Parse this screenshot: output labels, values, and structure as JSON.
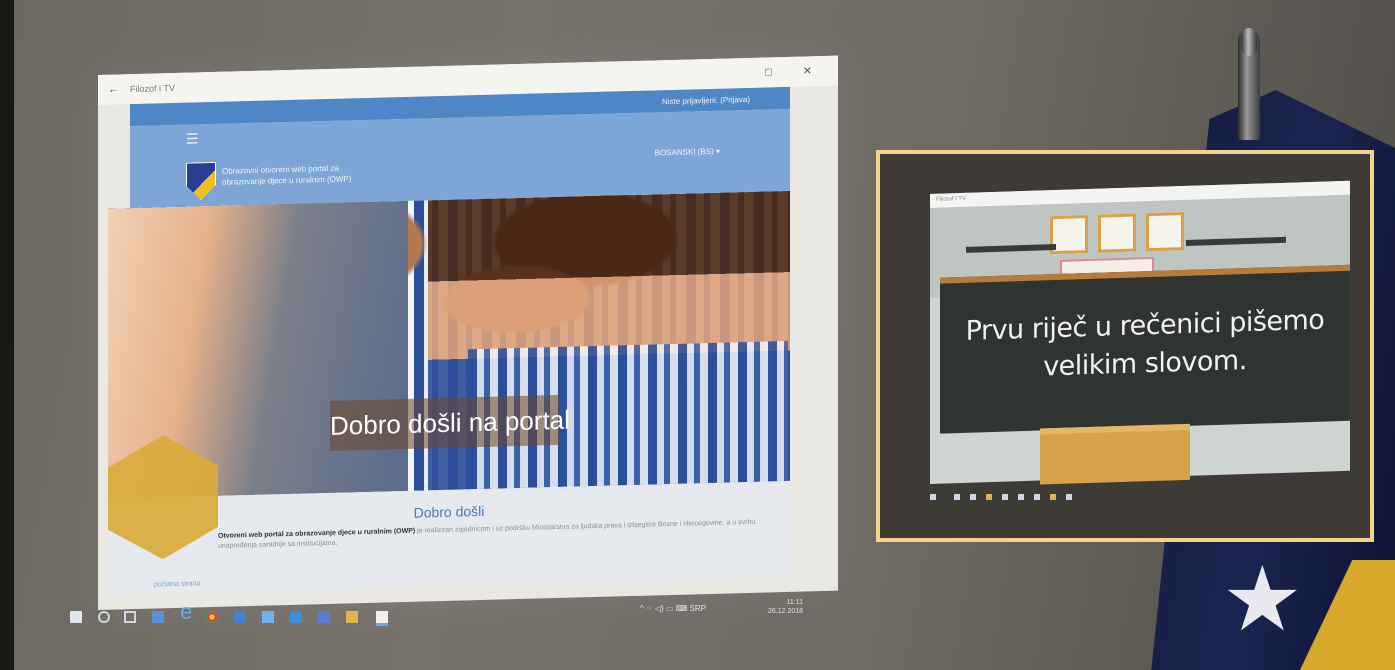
{
  "window": {
    "back": "←",
    "title": "Filozof i TV",
    "controls": "□ ✕"
  },
  "site": {
    "login": "Niste prijavljeni. (Prijava) ",
    "hamburger": "☰",
    "logo_text": "Obrazovni otvoreni web portal za obrazovanje djece u ruralnim (OWP)",
    "language": "BOSANSKI (BS) ▾",
    "hero_banner": "Dobro došli na portal",
    "intro_title": "Dobro došli",
    "intro_bold": "Otvoreni web portal za obrazovanje djece u ruralnim (OWP)",
    "intro_rest": " je realiziran zajednicom i uz podršku Ministarstva za ljudska prava i izbjeglice Bosne i Hercegovine, a u svrhu unapređenja saradnje sa institucijama.",
    "bottom_link": "početna strana"
  },
  "taskbar": {
    "tray": "^ ⁘ ◁) ▭ ⌨ SRP",
    "time": "11:11",
    "date": "26.12.2018"
  },
  "inset": {
    "window_title": "Filozof i TV",
    "board_line1": "Prvu riječ u rečenici pišemo",
    "board_line2": "velikim slovom."
  },
  "colors": {
    "site_blue": "#4f86c6",
    "header_blue": "#7da5d6",
    "hexagon": "#d9ab3b",
    "inset_border": "#f3d48a"
  }
}
